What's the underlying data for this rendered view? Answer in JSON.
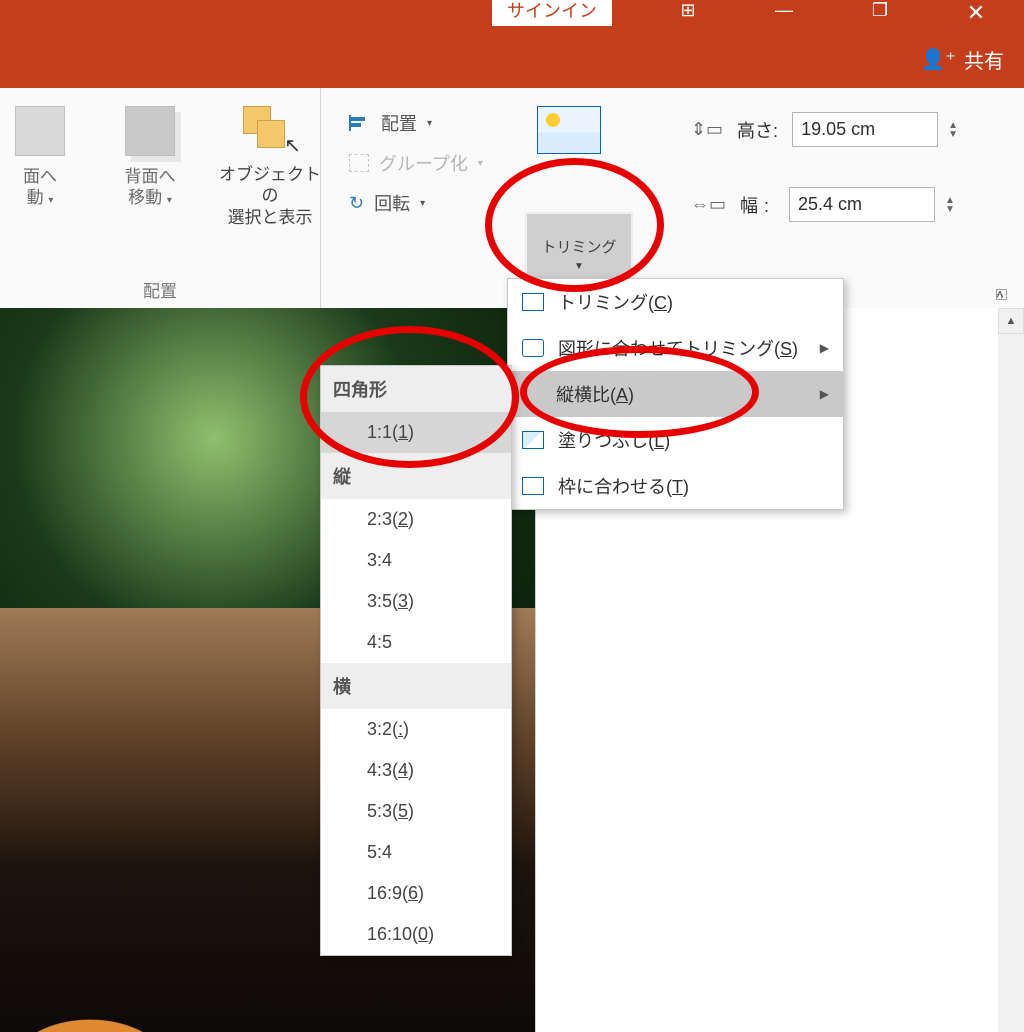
{
  "title": {
    "signin": "サインイン",
    "share": "共有"
  },
  "ribbon": {
    "arrange": {
      "send_back": "面へ",
      "send_back2": "動",
      "forward": "背面へ",
      "forward2": "移動",
      "selpane1": "オブジェクトの",
      "selpane2": "選択と表示",
      "align": "配置",
      "group": "グループ化",
      "rotate": "回転",
      "group_label": "配置"
    },
    "trim": {
      "button": "トリミング",
      "height_label": "高さ:",
      "height_val": "19.05 cm",
      "width_label": "幅:",
      "width_val": "25.4 cm"
    }
  },
  "menu": {
    "crop": "トリミング(C)",
    "shape": "図形に合わせてトリミング(S)",
    "aspect": "縦横比(A)",
    "fill": "塗りつぶし(L)",
    "fit": "枠に合わせる(T)"
  },
  "aspect": {
    "cat_square": "四角形",
    "r11": "1:1(1)",
    "cat_port": "縦",
    "r23": "2:3(2)",
    "r34": "3:4",
    "r35": "3:5(3)",
    "r45": "4:5",
    "cat_land": "横",
    "r32": "3:2(:)",
    "r43": "4:3(4)",
    "r53": "5:3(5)",
    "r54": "5:4",
    "r169": "16:9(6)",
    "r1610": "16:10(0)"
  }
}
